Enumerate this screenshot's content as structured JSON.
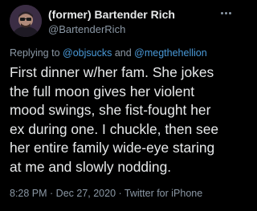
{
  "tweet": {
    "display_name": "(former) Bartender Rich",
    "handle": "@BartenderRich",
    "replying_prefix": "Replying to ",
    "reply_user_1": "@objsucks",
    "reply_join": " and ",
    "reply_user_2": "@megthehellion",
    "body_lines": [
      "First dinner w/her fam. She jokes",
      "the full moon gives her violent",
      "mood swings, she fist-fought her",
      "ex during one. I chuckle, then see",
      "her entire family wide-eye staring",
      "at me and slowly nodding."
    ],
    "time": "8:28 PM",
    "date": "Dec 27, 2020",
    "source": "Twitter for iPhone",
    "separator": " · "
  },
  "icons": {
    "avatar": "profile-avatar",
    "more": "more-options-icon"
  },
  "colors": {
    "background": "#000000",
    "text": "#e7e9ea",
    "secondary": "#8b98a5",
    "link": "#4a9ad9"
  }
}
